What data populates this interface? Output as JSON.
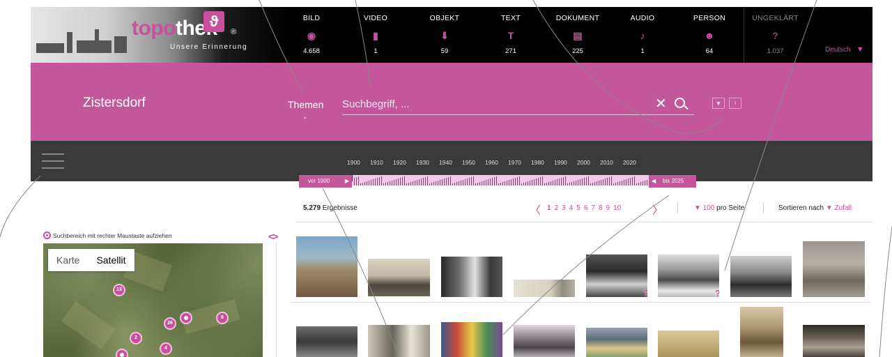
{
  "brand": {
    "logo_topo": "topo",
    "logo_thek": "thek",
    "logo_mark": "ϑ",
    "registered": "®",
    "tagline": "Unsere Erinnerung",
    "accent_color": "#c4579c"
  },
  "media_types": [
    {
      "label": "BILD",
      "count": "4.658",
      "icon": "image-icon"
    },
    {
      "label": "VIDEO",
      "count": "1",
      "icon": "film-icon"
    },
    {
      "label": "OBJEKT",
      "count": "59",
      "icon": "object-icon"
    },
    {
      "label": "TEXT",
      "count": "271",
      "icon": "text-icon"
    },
    {
      "label": "DOKUMENT",
      "count": "225",
      "icon": "document-icon"
    },
    {
      "label": "AUDIO",
      "count": "1",
      "icon": "music-icon"
    },
    {
      "label": "PERSON",
      "count": "64",
      "icon": "person-icon"
    },
    {
      "label": "UNGEKLÄRT",
      "count": "1.037",
      "icon": "question-icon"
    }
  ],
  "language": {
    "selected": "Deutsch",
    "arrow": "▼"
  },
  "header": {
    "site_name": "Zistersdorf",
    "themen_label": "Themen",
    "themen_chevron": "⌄"
  },
  "search": {
    "placeholder": "Suchbegriff, ...",
    "clear_glyph": "✕",
    "options_glyph": "▼",
    "info_glyph": "i"
  },
  "timeline": {
    "years": [
      "1900",
      "1910",
      "1920",
      "1930",
      "1940",
      "1950",
      "1960",
      "1970",
      "1980",
      "1990",
      "2000",
      "2010",
      "2020"
    ],
    "from_label": "vor 1900",
    "to_label": "bis 2025",
    "from_arrow": "▶",
    "to_arrow": "◀"
  },
  "results": {
    "count": "5.279",
    "count_label": " Ergebnisse",
    "prev_glyph": "〈",
    "next_glyph": "〉",
    "pages": [
      "1",
      "2",
      "3",
      "4",
      "5",
      "6",
      "7",
      "8",
      "9",
      "10"
    ],
    "current_page": "1",
    "per_page_arrow": "▼",
    "per_page_value": "100",
    "per_page_label": " pro Seite",
    "sort_label": "Sortieren nach ",
    "sort_arrow": "▼",
    "sort_value": "Zufall"
  },
  "map": {
    "hint": "Suchbereich mit rechter Maustaste aufziehen",
    "collapse_glyph": "<>",
    "toggle_karte": "Karte",
    "toggle_satellit": "Satellit",
    "clusters": [
      "13",
      "26",
      "8",
      "2",
      "4"
    ]
  },
  "thumbnail_badge": "?"
}
